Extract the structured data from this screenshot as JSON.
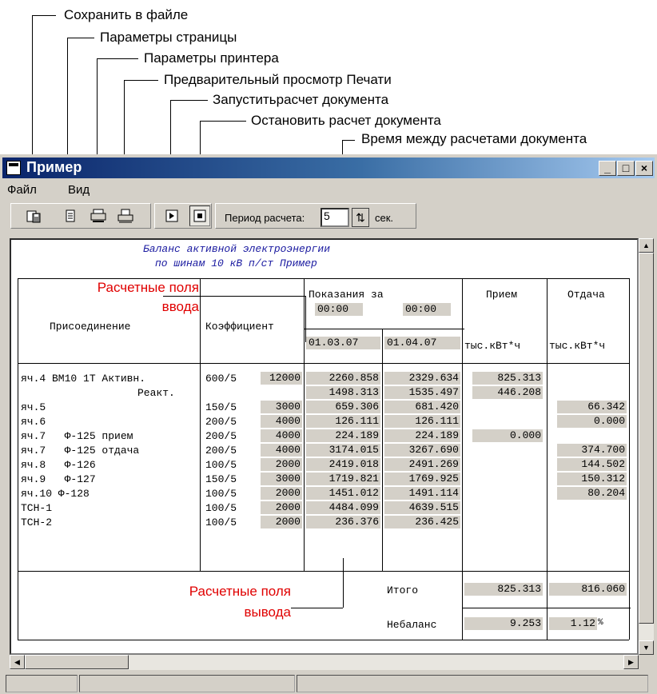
{
  "callouts": {
    "save": "Сохранить в файле",
    "page_params": "Параметры страницы",
    "printer_params": "Параметры принтера",
    "preview": "Предварительный просмотр Печати",
    "start_calc": "Запуститьрасчет документа",
    "stop_calc": "Остановить расчет документа",
    "interval": "Время между расчетами документа",
    "input_fields": [
      "Расчетные поля",
      "ввода"
    ],
    "output_fields": [
      "Расчетные поля",
      "вывода"
    ]
  },
  "window": {
    "title": "Пример",
    "menu": [
      "Файл",
      "Вид"
    ]
  },
  "toolbar": {
    "period_label": "Период расчета:",
    "period_value": "5",
    "period_unit": "сек."
  },
  "report": {
    "title_line1": "Баланс активной электроэнергии",
    "title_line2": "по шинам 10 кВ п/ст Пример",
    "headers": {
      "connection": "Присоединение",
      "coef": "Коэффициент",
      "readings": "Показания за",
      "time1": "00:00",
      "time2": "00:00",
      "date1": "01.03.07",
      "date2": "01.04.07",
      "intake": "Прием",
      "output": "Отдача",
      "unit1": "тыс.кВт*ч",
      "unit2": "тыс.кВт*ч"
    },
    "rows": [
      {
        "name": "яч.4 ВМ10 1Т Активн.",
        "ct": "600/5",
        "k": "12000",
        "r1": "2260.858",
        "r2": "2329.634",
        "in": "825.313",
        "out": ""
      },
      {
        "name": "Реакт.",
        "ct": "",
        "k": "",
        "r1": "1498.313",
        "r2": "1535.497",
        "in": "446.208",
        "out": ""
      },
      {
        "name": "яч.5",
        "ct": "150/5",
        "k": "3000",
        "r1": "659.306",
        "r2": "681.420",
        "in": "",
        "out": "66.342"
      },
      {
        "name": "яч.6",
        "ct": "200/5",
        "k": "4000",
        "r1": "126.111",
        "r2": "126.111",
        "in": "",
        "out": "0.000"
      },
      {
        "name": "яч.7   Ф-125 прием",
        "ct": "200/5",
        "k": "4000",
        "r1": "224.189",
        "r2": "224.189",
        "in": "0.000",
        "out": ""
      },
      {
        "name": "яч.7   Ф-125 отдача",
        "ct": "200/5",
        "k": "4000",
        "r1": "3174.015",
        "r2": "3267.690",
        "in": "",
        "out": "374.700"
      },
      {
        "name": "яч.8   Ф-126",
        "ct": "100/5",
        "k": "2000",
        "r1": "2419.018",
        "r2": "2491.269",
        "in": "",
        "out": "144.502"
      },
      {
        "name": "яч.9   Ф-127",
        "ct": "150/5",
        "k": "3000",
        "r1": "1719.821",
        "r2": "1769.925",
        "in": "",
        "out": "150.312"
      },
      {
        "name": "яч.10 Ф-128",
        "ct": "100/5",
        "k": "2000",
        "r1": "1451.012",
        "r2": "1491.114",
        "in": "",
        "out": "80.204"
      },
      {
        "name": "ТСН-1",
        "ct": "100/5",
        "k": "2000",
        "r1": "4484.099",
        "r2": "4639.515",
        "in": "",
        "out": ""
      },
      {
        "name": "ТСН-2",
        "ct": "100/5",
        "k": "2000",
        "r1": "236.376",
        "r2": "236.425",
        "in": "",
        "out": ""
      }
    ],
    "totals": {
      "total_label": "Итого",
      "total_in": "825.313",
      "total_out": "816.060",
      "imbalance_label": "Небаланс",
      "imbalance_value": "9.253",
      "imbalance_pct": "1.12",
      "pct_sign": "%"
    }
  },
  "colors": {
    "title_gradient_start": "#0a246a",
    "title_gradient_end": "#a6caf0",
    "field_bg": "#d4d0c8",
    "title_text": "#1a1aa0",
    "callout_red": "#e00000"
  }
}
